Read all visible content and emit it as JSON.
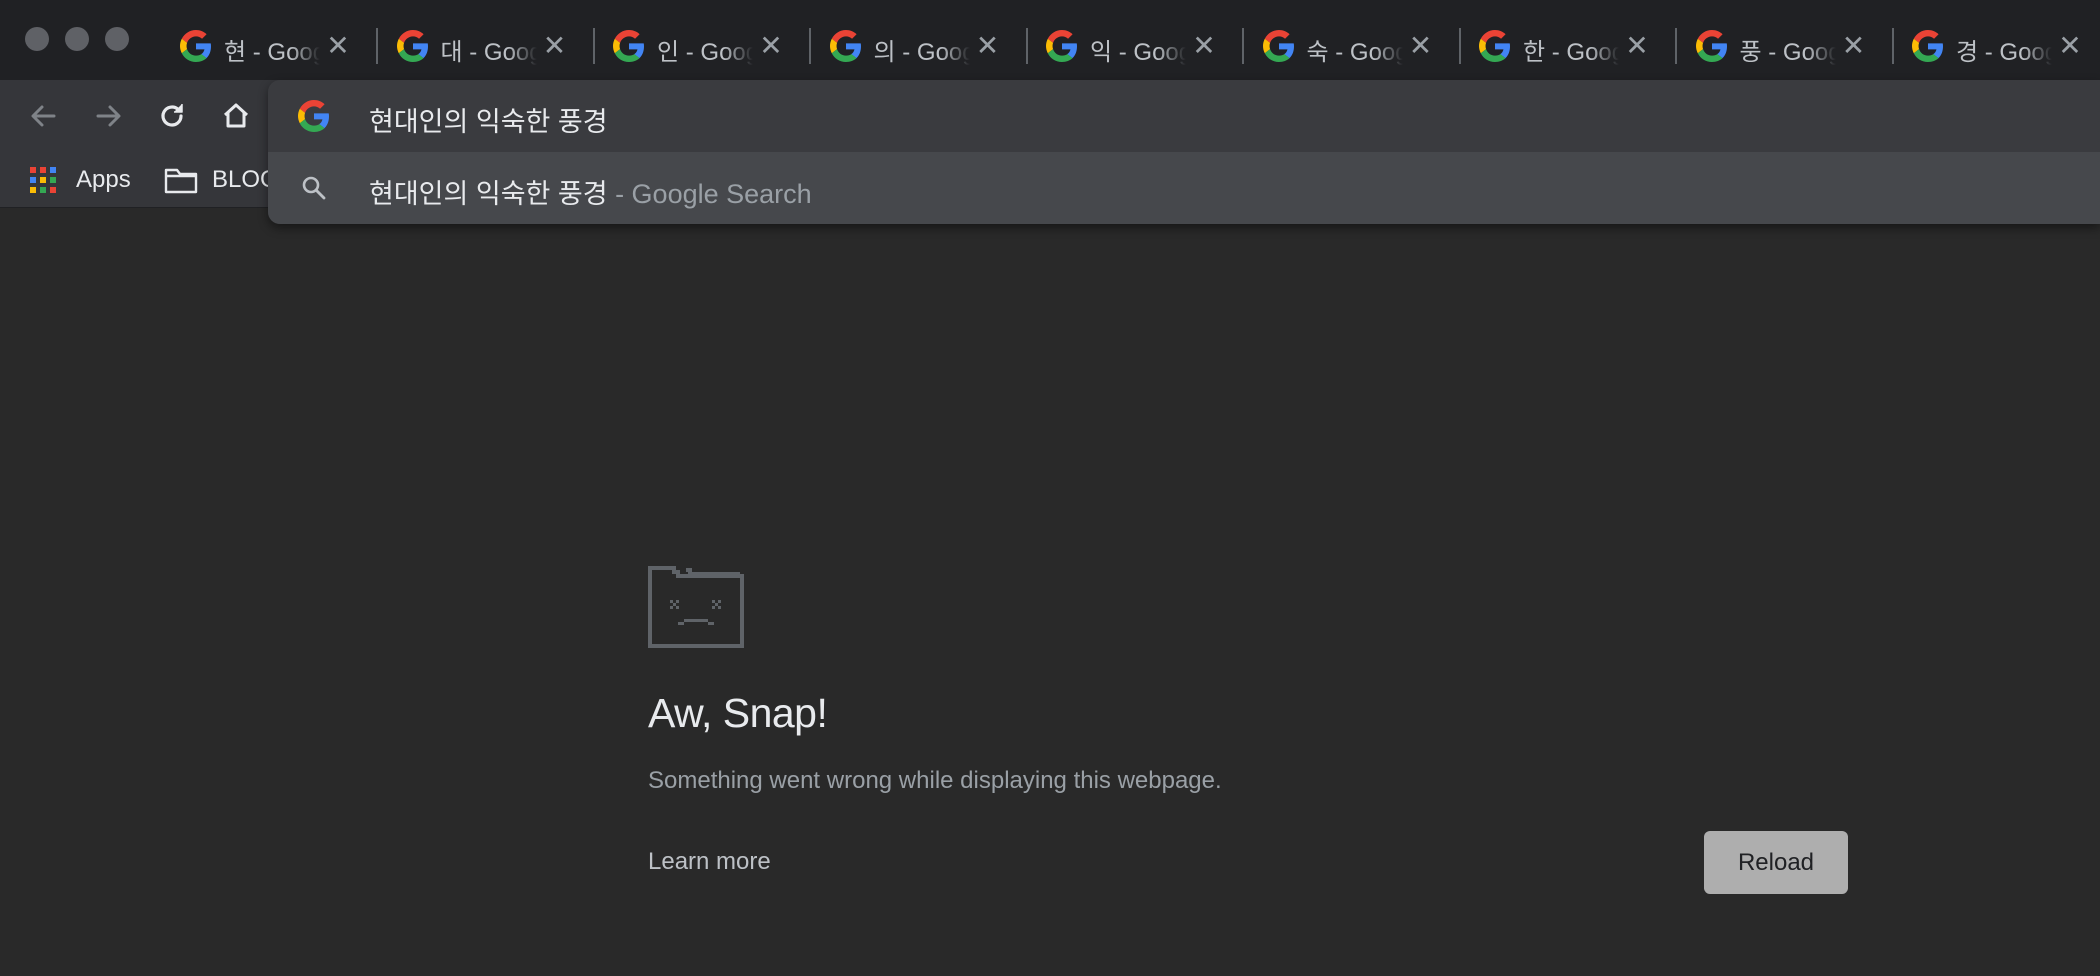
{
  "tabs": [
    {
      "title": "현 - Google Search"
    },
    {
      "title": "대 - Google Search"
    },
    {
      "title": "인 - Google Search"
    },
    {
      "title": "의 - Google Search"
    },
    {
      "title": "익 - Google Search"
    },
    {
      "title": "숙 - Google Search"
    },
    {
      "title": "한 - Google Search"
    },
    {
      "title": "풍 - Google Search"
    },
    {
      "title": "경 - Google Search"
    }
  ],
  "bookmarks": {
    "apps_label": "Apps",
    "folder_label": "BLOG"
  },
  "omnibox": {
    "input_value": "현대인의 익숙한 풍경",
    "suggestion_query": "현대인의 익숙한 풍경",
    "suggestion_suffix": " - Google Search"
  },
  "error_page": {
    "headline": "Aw, Snap!",
    "message": "Something went wrong while displaying this webpage.",
    "learn_more": "Learn more",
    "reload_label": "Reload"
  }
}
